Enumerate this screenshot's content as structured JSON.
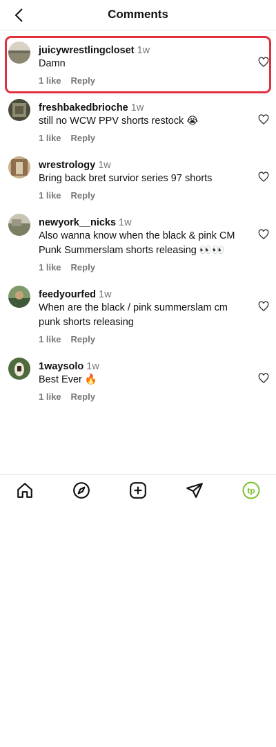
{
  "header": {
    "title": "Comments",
    "back_icon": "chevron-left-icon"
  },
  "comments": [
    {
      "username": "juicywrestlingcloset",
      "time": "1w",
      "text": "Damn",
      "likes": "1 like",
      "reply": "Reply",
      "highlighted": true,
      "avatar_color": "#b8b0a0"
    },
    {
      "username": "freshbakedbrioche",
      "time": "1w",
      "text": "still no WCW PPV shorts restock 😭",
      "likes": "1 like",
      "reply": "Reply",
      "avatar_color": "#6d6a58"
    },
    {
      "username": "wrestrology",
      "time": "1w",
      "text": "Bring back bret survior series 97 shorts",
      "likes": "1 like",
      "reply": "Reply",
      "avatar_color": "#9a7a5a"
    },
    {
      "username": "newyork__nicks",
      "time": "1w",
      "text": "Also wanna know when the black & pink CM Punk Summerslam shorts releasing 👀👀",
      "likes": "1 like",
      "reply": "Reply",
      "avatar_color": "#8a8f76"
    },
    {
      "username": "feedyourfed",
      "time": "1w",
      "text": "When are the black / pink summerslam cm punk shorts releasing",
      "likes": "1 like",
      "reply": "Reply",
      "avatar_color": "#5f7a58"
    },
    {
      "username": "1waysolo",
      "time": "1w",
      "text": "Best Ever 🔥",
      "likes": "1 like",
      "reply": "Reply",
      "avatar_color": "#4a5a3a"
    }
  ],
  "tabbar": {
    "items": [
      "home-icon",
      "explore-icon",
      "create-icon",
      "send-icon",
      "profile-icon"
    ],
    "profile_badge": "tp",
    "profile_color": "#7cc22e"
  }
}
